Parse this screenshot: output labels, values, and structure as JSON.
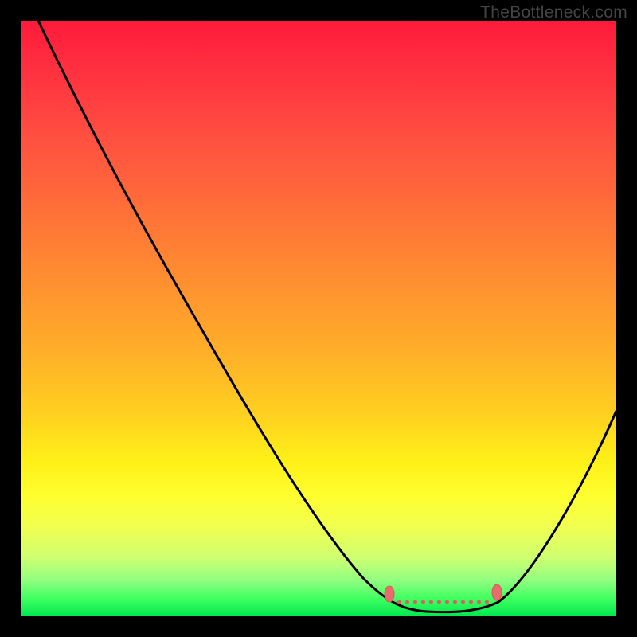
{
  "watermark": "TheBottleneck.com",
  "colors": {
    "background": "#000000",
    "curve": "#000000",
    "marker": "#e96b6b",
    "gradient_top": "#ff1a3a",
    "gradient_bottom": "#00e850"
  },
  "chart_data": {
    "type": "line",
    "title": "",
    "xlabel": "",
    "ylabel": "",
    "xlim": [
      0,
      100
    ],
    "ylim": [
      0,
      100
    ],
    "series": [
      {
        "name": "bottleneck-curve",
        "x": [
          3,
          10,
          20,
          30,
          40,
          50,
          58,
          62,
          66,
          72,
          76,
          80,
          86,
          92,
          100
        ],
        "y": [
          100,
          88,
          72,
          56,
          40,
          24,
          10,
          4,
          1,
          0,
          0,
          1,
          8,
          20,
          38
        ]
      }
    ],
    "markers": [
      {
        "x": 62,
        "y": 4
      },
      {
        "x": 80,
        "y": 4
      }
    ],
    "dotted_segment": {
      "x_start": 63,
      "x_end": 79,
      "y": 1.5
    },
    "description": "V-shaped bottleneck curve over red-to-green vertical gradient; lowest (best) region between x≈62 and x≈80 marked with salmon markers and dotted baseline."
  }
}
